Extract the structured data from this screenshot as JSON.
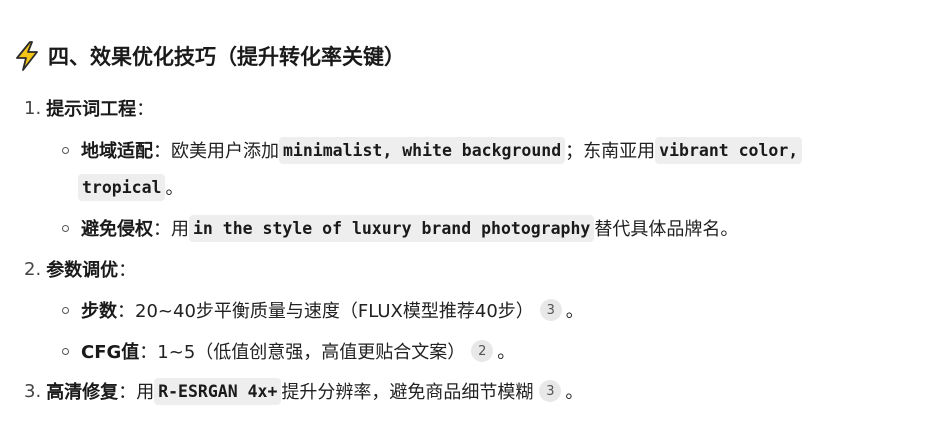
{
  "heading": {
    "icon": "lightning-icon",
    "title": "四、效果优化技巧（提升转化率关键）"
  },
  "items": [
    {
      "number": "1.",
      "title": "提示词工程",
      "colon": "：",
      "subitems": [
        {
          "title": "地域适配",
          "colon": "：",
          "text1": "欧美用户添加",
          "code1": "minimalist, white background",
          "text2": "；东南亚用",
          "code2a": "vibrant color,",
          "code2b": "tropical",
          "text3": "。"
        },
        {
          "title": "避免侵权",
          "colon": "：",
          "text1": "用",
          "code1": "in the style of luxury brand photography",
          "text2": "替代具体品牌名。"
        }
      ]
    },
    {
      "number": "2.",
      "title": "参数调优",
      "colon": "：",
      "subitems": [
        {
          "title": "步数",
          "colon": "：",
          "text1": "20~40步平衡质量与速度（FLUX模型推荐40步）",
          "cite": "3",
          "text2": "。"
        },
        {
          "title": "CFG值",
          "colon": "：",
          "text1": "1~5（低值创意强，高值更贴合文案）",
          "cite": "2",
          "text2": "。"
        }
      ]
    },
    {
      "number": "3.",
      "title": "高清修复",
      "colon": "：",
      "text1": "用",
      "code1": "R-ESRGAN 4x+",
      "text2": "提升分辨率，避免商品细节模糊",
      "cite": "3",
      "text3": "。"
    }
  ],
  "colors": {
    "code_bg": "#eeeeee",
    "cite_bg": "#e8e8e8",
    "bolt_fill": "#f5c518",
    "bolt_stroke": "#2b2b2b"
  }
}
